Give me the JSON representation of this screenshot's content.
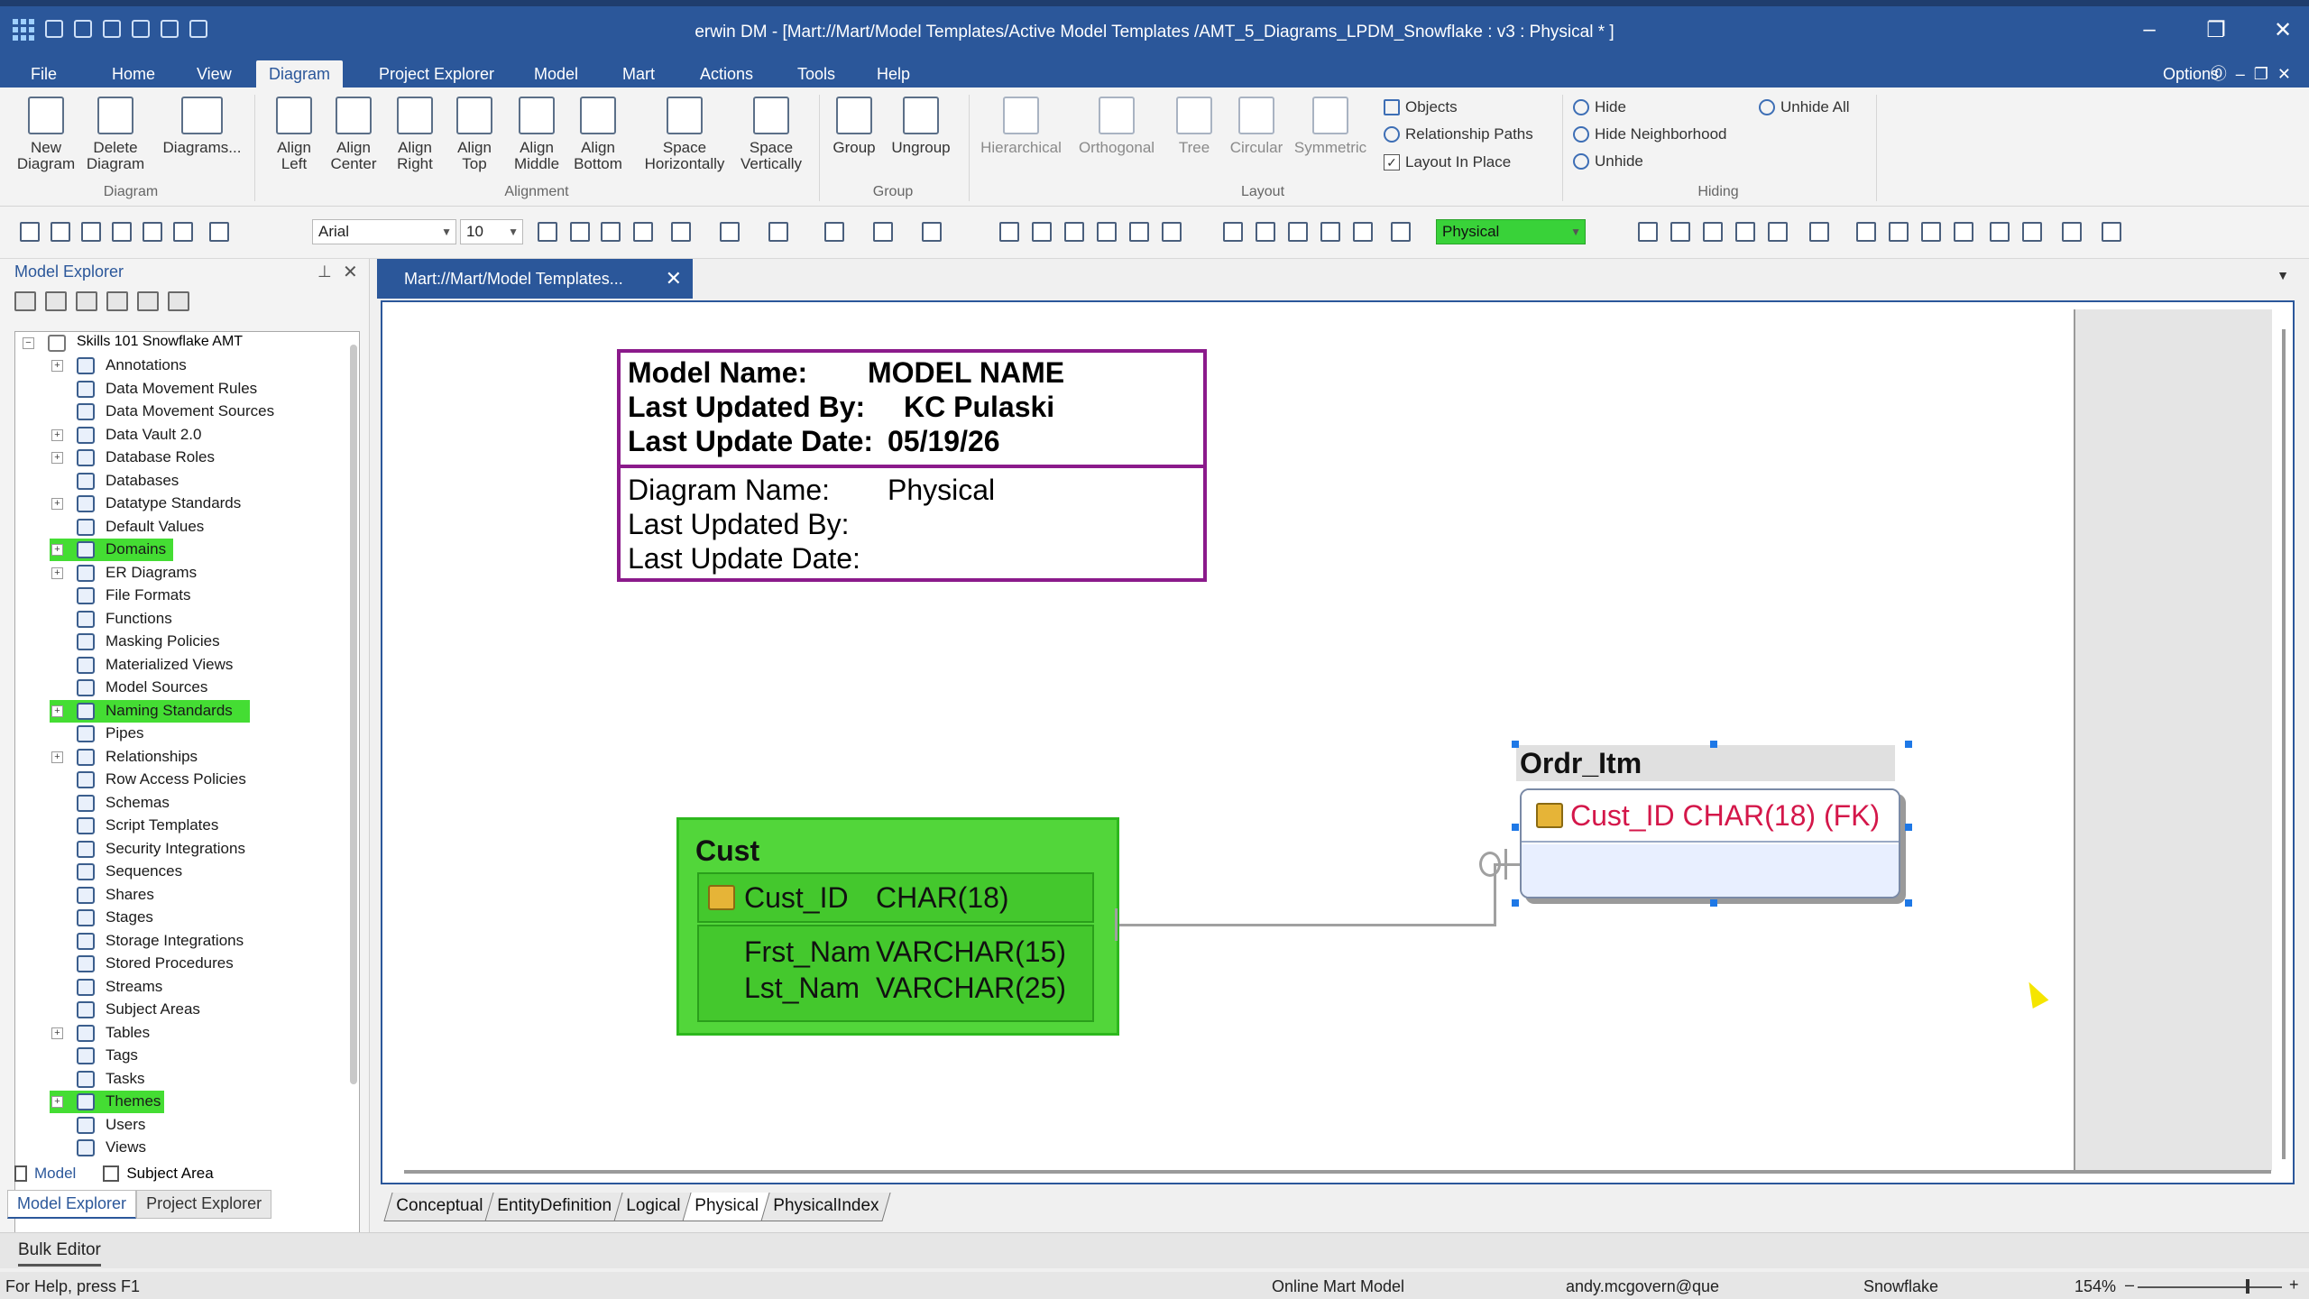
{
  "window": {
    "title": "erwin DM - [Mart://Mart/Model Templates/Active Model Templates /AMT_5_Diagrams_LPDM_Snowflake : v3  : Physical * ]",
    "controls": {
      "minimize": "–",
      "restore": "❐",
      "close": "✕"
    }
  },
  "ribbon_tabs": [
    "File",
    "Home",
    "View",
    "Diagram",
    "Project Explorer",
    "Model",
    "Mart",
    "Actions",
    "Tools",
    "Help"
  ],
  "ribbon_options": "Options",
  "ribbon": {
    "diagram_group": {
      "label": "Diagram",
      "new": "New Diagram",
      "delete": "Delete Diagram",
      "diagrams": "Diagrams..."
    },
    "alignment_group": {
      "label": "Alignment",
      "left": "Align Left",
      "center": "Align Center",
      "right": "Align Right",
      "top": "Align Top",
      "middle": "Align Middle",
      "bottom": "Align Bottom",
      "space_h": "Space Horizontally",
      "space_v": "Space Vertically"
    },
    "group_group": {
      "label": "Group",
      "group": "Group",
      "ungroup": "Ungroup"
    },
    "layout_group": {
      "label": "Layout",
      "hierarchical": "Hierarchical",
      "orthogonal": "Orthogonal",
      "tree": "Tree",
      "circular": "Circular",
      "symmetric": "Symmetric",
      "objects": "Objects",
      "relationship_paths": "Relationship Paths",
      "layout_in_place": "Layout In Place",
      "layout_in_place_checked": true
    },
    "hiding_group": {
      "label": "Hiding",
      "hide": "Hide",
      "hide_neighborhood": "Hide Neighborhood",
      "unhide": "Unhide",
      "unhide_all": "Unhide All"
    }
  },
  "toolbar": {
    "font": "Arial",
    "font_size": "10",
    "theme": "Physical"
  },
  "explorer": {
    "title": "Model Explorer",
    "root": "Skills 101 Snowflake AMT",
    "items": [
      {
        "label": "Annotations",
        "expandable": true,
        "highlight": false
      },
      {
        "label": "Data Movement Rules",
        "expandable": false,
        "highlight": false
      },
      {
        "label": "Data Movement Sources",
        "expandable": false,
        "highlight": false
      },
      {
        "label": "Data Vault 2.0",
        "expandable": true,
        "highlight": false
      },
      {
        "label": "Database Roles",
        "expandable": true,
        "highlight": false
      },
      {
        "label": "Databases",
        "expandable": false,
        "highlight": false
      },
      {
        "label": "Datatype Standards",
        "expandable": true,
        "highlight": false
      },
      {
        "label": "Default Values",
        "expandable": false,
        "highlight": false
      },
      {
        "label": "Domains",
        "expandable": true,
        "highlight": true
      },
      {
        "label": "ER Diagrams",
        "expandable": true,
        "highlight": false
      },
      {
        "label": "File Formats",
        "expandable": false,
        "highlight": false
      },
      {
        "label": "Functions",
        "expandable": false,
        "highlight": false
      },
      {
        "label": "Masking Policies",
        "expandable": false,
        "highlight": false
      },
      {
        "label": "Materialized Views",
        "expandable": false,
        "highlight": false
      },
      {
        "label": "Model Sources",
        "expandable": false,
        "highlight": false
      },
      {
        "label": "Naming Standards",
        "expandable": true,
        "highlight": true
      },
      {
        "label": "Pipes",
        "expandable": false,
        "highlight": false
      },
      {
        "label": "Relationships",
        "expandable": true,
        "highlight": false
      },
      {
        "label": "Row Access Policies",
        "expandable": false,
        "highlight": false
      },
      {
        "label": "Schemas",
        "expandable": false,
        "highlight": false
      },
      {
        "label": "Script Templates",
        "expandable": false,
        "highlight": false
      },
      {
        "label": "Security Integrations",
        "expandable": false,
        "highlight": false
      },
      {
        "label": "Sequences",
        "expandable": false,
        "highlight": false
      },
      {
        "label": "Shares",
        "expandable": false,
        "highlight": false
      },
      {
        "label": "Stages",
        "expandable": false,
        "highlight": false
      },
      {
        "label": "Storage Integrations",
        "expandable": false,
        "highlight": false
      },
      {
        "label": "Stored Procedures",
        "expandable": false,
        "highlight": false
      },
      {
        "label": "Streams",
        "expandable": false,
        "highlight": false
      },
      {
        "label": "Subject Areas",
        "expandable": false,
        "highlight": false
      },
      {
        "label": "Tables",
        "expandable": true,
        "highlight": false
      },
      {
        "label": "Tags",
        "expandable": false,
        "highlight": false
      },
      {
        "label": "Tasks",
        "expandable": false,
        "highlight": false
      },
      {
        "label": "Themes",
        "expandable": true,
        "highlight": true
      },
      {
        "label": "Users",
        "expandable": false,
        "highlight": false
      },
      {
        "label": "Views",
        "expandable": false,
        "highlight": false
      }
    ],
    "bottom_tabs": [
      "Model",
      "Subject Area"
    ],
    "panel_tabs": [
      "Model Explorer",
      "Project Explorer"
    ]
  },
  "doc_tab": "Mart://Mart/Model Templates...",
  "title_block": {
    "model_name_label": "Model Name:",
    "model_name_value": "MODEL NAME",
    "last_updated_by_label": "Last Updated By:",
    "last_updated_by_value": "KC Pulaski",
    "last_update_date_label": "Last Update Date:",
    "last_update_date_value": "05/19/26",
    "diagram_name_label": "Diagram Name:",
    "diagram_name_value": "Physical",
    "diagram_last_updated_by_label": "Last Updated By:",
    "diagram_last_update_date_label": "Last Update Date:"
  },
  "entities": {
    "cust": {
      "name": "Cust",
      "key": {
        "name": "Cust_ID",
        "type": "CHAR(18)"
      },
      "attrs": [
        {
          "name": "Frst_Nam",
          "type": "VARCHAR(15)"
        },
        {
          "name": "Lst_Nam",
          "type": "VARCHAR(25)"
        }
      ]
    },
    "ordr_itm": {
      "name": "Ordr_Itm",
      "key_text": "Cust_ID CHAR(18) (FK)",
      "key_color": "#d4174a"
    }
  },
  "diagram_tabs": [
    "Conceptual",
    "EntityDefinition",
    "Logical",
    "Physical",
    "PhysicalIndex"
  ],
  "active_diagram_tab": "Physical",
  "bulk_editor": "Bulk Editor",
  "status": {
    "help": "For Help, press F1",
    "mode": "Online Mart Model",
    "user": "andy.mcgovern@que",
    "platform": "Snowflake",
    "zoom": "154%"
  },
  "colors": {
    "accent": "#2b579a",
    "highlight_green": "#44dd33",
    "entity_green": "#52d63a",
    "title_block_border": "#8b1a8b"
  }
}
